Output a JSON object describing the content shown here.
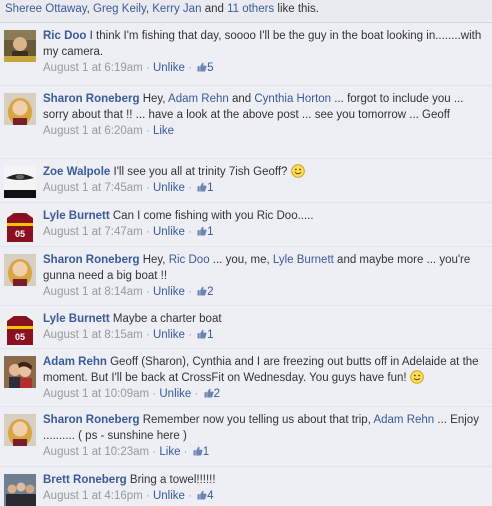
{
  "likes_bar": {
    "names": [
      "Sheree Ottaway",
      "Greg Keily",
      "Kerry Jan"
    ],
    "and_text": "and",
    "others_link": "11 others",
    "suffix": "like this.",
    "sep": ",",
    "space": " "
  },
  "ui": {
    "dot": " · ",
    "like_label": "Like",
    "unlike_label": "Unlike"
  },
  "comments": [
    {
      "author": "Ric Doo",
      "text": "I think I'm fishing that day, soooo I'll be the guy in the boat looking in........with my camera.",
      "time": "August 1 at 6:19am",
      "action": "Unlike",
      "like_count": "5"
    },
    {
      "author": "Sharon Roneberg",
      "t1": "Hey,",
      "mention1": "Adam Rehn",
      "t2": "and",
      "mention2": "Cynthia Horton",
      "t3": "... forgot to include you ... sorry about that !! ... have a look at the above post ... see you tomorrow ... Geoff",
      "time": "August 1 at 6:20am",
      "action": "Like"
    },
    {
      "author": "Zoe Walpole",
      "text": "I'll see you all at trinity 7ish Geoff?",
      "time": "August 1 at 7:45am",
      "action": "Unlike",
      "like_count": "1"
    },
    {
      "author": "Lyle Burnett",
      "text": "Can I come fishing with you Ric Doo.....",
      "time": "August 1 at 7:47am",
      "action": "Unlike",
      "like_count": "1"
    },
    {
      "author": "Sharon Roneberg",
      "t1": "Hey,",
      "mention1": "Ric Doo",
      "t2": "... you, me,",
      "mention2": "Lyle Burnett",
      "t3": "and maybe more ... you're gunna need a big boat !!",
      "time": "August 1 at 8:14am",
      "action": "Unlike",
      "like_count": "2"
    },
    {
      "author": "Lyle Burnett",
      "text": "Maybe a charter boat",
      "time": "August 1 at 8:15am",
      "action": "Unlike",
      "like_count": "1"
    },
    {
      "author": "Adam Rehn",
      "text": "Geoff (Sharon), Cynthia and I are freezing out butts off in Adelaide at the moment. But I'll be back at CrossFit on Wednesday. You guys have fun!",
      "time": "August 1 at 10:09am",
      "action": "Unlike",
      "like_count": "2"
    },
    {
      "author": "Sharon Roneberg",
      "t1": "Remember now you telling us about that trip,",
      "mention1": "Adam Rehn",
      "t2": "... Enjoy .......... ( ps - sunshine here )",
      "time": "August 1 at 10:23am",
      "action": "Like",
      "like_count": "1"
    },
    {
      "author": "Brett Roneberg",
      "text": "Bring a towel!!!!!!",
      "time": "August 1 at 4:16pm",
      "action": "Unlike",
      "like_count": "4"
    }
  ],
  "colors": {
    "link": "#3b5998",
    "meta": "#989898",
    "thread_bg": "#edeff4",
    "likes_bg": "#e9ebf1"
  },
  "icons": {
    "like": "thumbs-up-icon",
    "emoticon": "smiley-icon"
  }
}
